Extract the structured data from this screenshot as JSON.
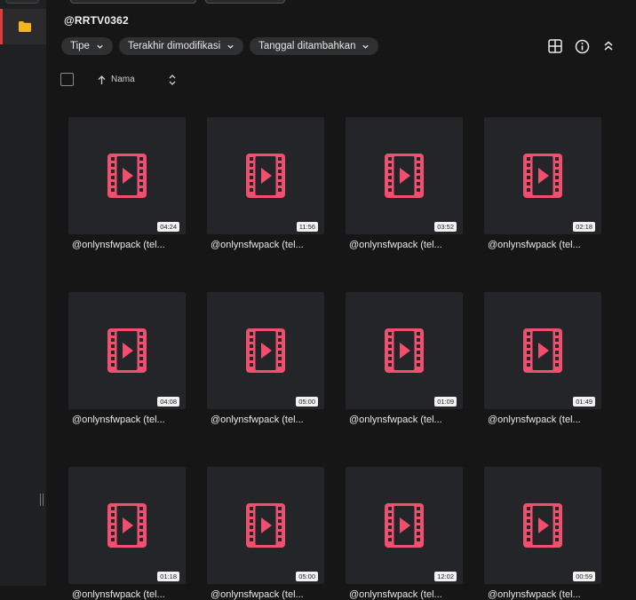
{
  "folder": {
    "title": "@RRTV0362"
  },
  "filters": [
    {
      "label": "Tipe"
    },
    {
      "label": "Terakhir dimodifikasi"
    },
    {
      "label": "Tanggal ditambahkan"
    }
  ],
  "sort": {
    "label": "Nama"
  },
  "colors": {
    "accent": "#e23a3a",
    "video_icon": "#f0506e",
    "background": "#161616",
    "card": "#242528"
  },
  "files": [
    {
      "name": "@onlynsfwpack (tel...",
      "duration": "04:24"
    },
    {
      "name": "@onlynsfwpack (tel...",
      "duration": "11:56"
    },
    {
      "name": "@onlynsfwpack (tel...",
      "duration": "03:52"
    },
    {
      "name": "@onlynsfwpack (tel...",
      "duration": "02:18"
    },
    {
      "name": "@onlynsfwpack (tel...",
      "duration": "04:08"
    },
    {
      "name": "@onlynsfwpack (tel...",
      "duration": "05:00"
    },
    {
      "name": "@onlynsfwpack (tel...",
      "duration": "01:09"
    },
    {
      "name": "@onlynsfwpack (tel...",
      "duration": "01:49"
    },
    {
      "name": "@onlynsfwpack (tel...",
      "duration": "01:18"
    },
    {
      "name": "@onlynsfwpack (tel...",
      "duration": "05:00"
    },
    {
      "name": "@onlynsfwpack (tel...",
      "duration": "12:02"
    },
    {
      "name": "@onlynsfwpack (tel...",
      "duration": "00:59"
    }
  ]
}
